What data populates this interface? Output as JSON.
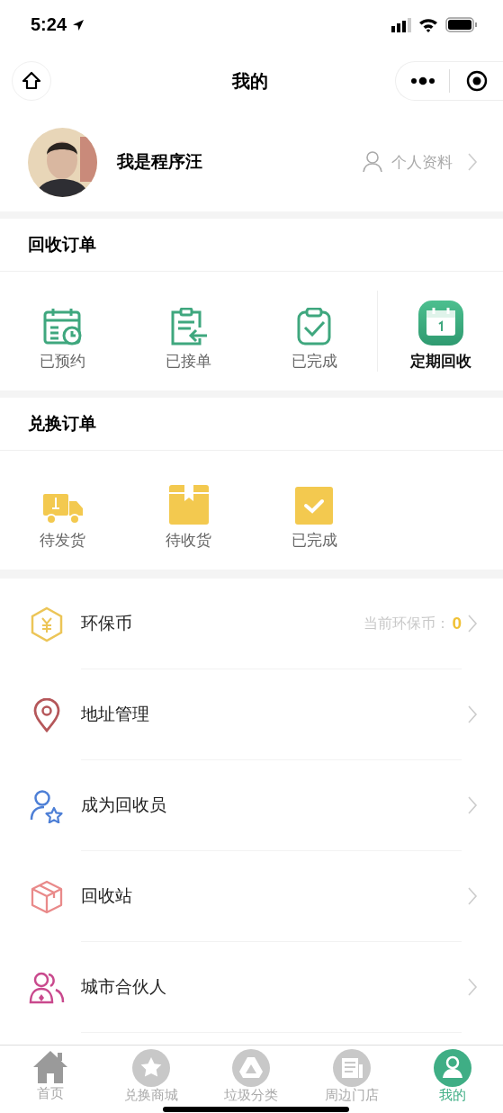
{
  "status_bar": {
    "time": "5:24"
  },
  "nav": {
    "title": "我的"
  },
  "profile": {
    "name": "我是程序汪",
    "link": "个人资料"
  },
  "recycle_orders": {
    "title": "回收订单",
    "items": [
      {
        "label": "已预约",
        "kind": "status"
      },
      {
        "label": "已接单",
        "kind": "status"
      },
      {
        "label": "已完成",
        "kind": "status"
      },
      {
        "label": "定期回收",
        "kind": "feature"
      }
    ]
  },
  "exchange_orders": {
    "title": "兑换订单",
    "items": [
      {
        "label": "待发货",
        "kind": "status"
      },
      {
        "label": "待收货",
        "kind": "status"
      },
      {
        "label": "已完成",
        "kind": "status"
      }
    ]
  },
  "menu": [
    {
      "label": "环保币",
      "note": "当前环保币：",
      "value": "0"
    },
    {
      "label": "地址管理"
    },
    {
      "label": "成为回收员"
    },
    {
      "label": "回收站"
    },
    {
      "label": "城市合伙人"
    }
  ],
  "tabs": [
    {
      "label": "首页",
      "selected": false
    },
    {
      "label": "兑换商城",
      "selected": false
    },
    {
      "label": "垃圾分类",
      "selected": false
    },
    {
      "label": "周边门店",
      "selected": false
    },
    {
      "label": "我的",
      "selected": true
    }
  ]
}
